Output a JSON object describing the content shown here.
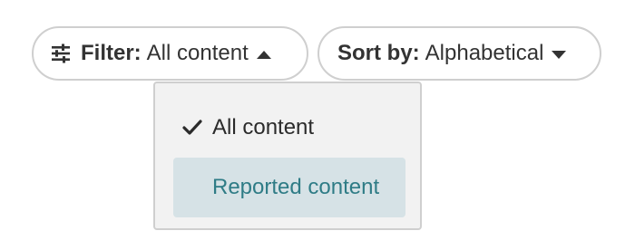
{
  "filter": {
    "label": "Filter:",
    "value": "All content",
    "icon": "sliders-icon",
    "caret": "caret-up-icon"
  },
  "sort": {
    "label": "Sort by:",
    "value": "Alphabetical",
    "caret": "caret-down-icon"
  },
  "dropdown": {
    "items": [
      {
        "label": "All content",
        "selected": true
      },
      {
        "label": "Reported content",
        "selected": false
      }
    ]
  },
  "colors": {
    "border": "#cfcfcf",
    "text": "#333333",
    "dropdown_bg": "#f2f2f2",
    "hover_bg": "#d6e2e6",
    "hover_text": "#2f7c86"
  }
}
